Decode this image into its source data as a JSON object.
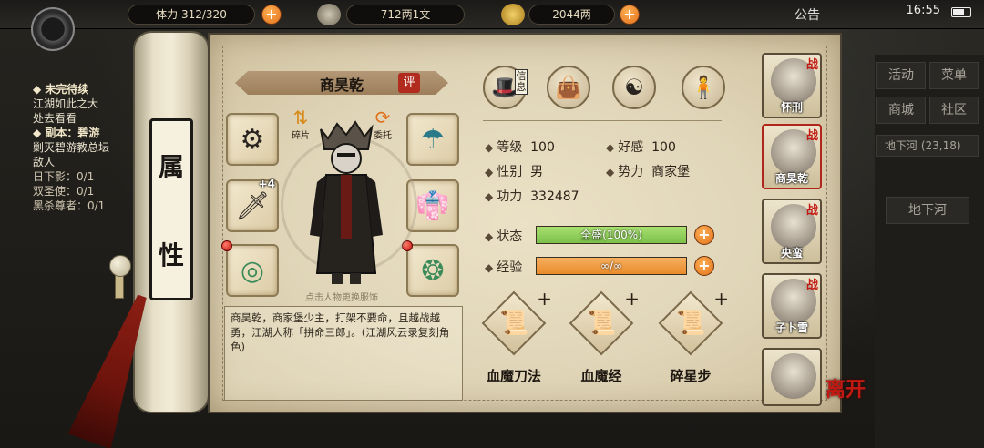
{
  "topbar": {
    "stamina": "体力 312/320",
    "copper": "712两1文",
    "silver": "2044两",
    "announce": "公告",
    "time": "16:55"
  },
  "quests": {
    "section1_title": "◆ 未完待续",
    "section1_line1": "江湖如此之大",
    "section1_line2": "处去看看",
    "section2_title": "◆ 副本：碧游",
    "section2_line1": "剿灭碧游教总坛",
    "section2_line2": "敌人",
    "line_a": "日下影：0/1",
    "line_b": "双圣使：0/1",
    "line_c": "黑杀尊者：0/1"
  },
  "right_menu": {
    "activity": "活动",
    "menu": "菜单",
    "shop": "商城",
    "community": "社区",
    "location": "地下河",
    "coords": "(23,18)",
    "location_btn": "地下河"
  },
  "scroll_label": [
    "属",
    "性"
  ],
  "character": {
    "name": "商昊乾",
    "eval": "评",
    "fragment_label": "碎片",
    "entrust_label": "委托",
    "change_hint": "点击人物更换服饰",
    "weapon_level": "+4",
    "bio": "商昊乾，商家堡少主，打架不要命，且越战越勇，江湖人称「拼命三郎」。(江湖风云录复刻角色)"
  },
  "tabs": {
    "info_tag": "信息"
  },
  "stats": {
    "level_label": "等级",
    "level_value": "100",
    "favor_label": "好感",
    "favor_value": "100",
    "gender_label": "性别",
    "gender_value": "男",
    "faction_label": "势力",
    "faction_value": "商家堡",
    "power_label": "功力",
    "power_value": "332487",
    "status_label": "状态",
    "status_value": "全盛(100%)",
    "status_ratio": 1.0,
    "exp_label": "经验",
    "exp_value": "∞/∞",
    "exp_ratio": 1.0
  },
  "skills": [
    {
      "name": "血魔刀法"
    },
    {
      "name": "血魔经"
    },
    {
      "name": "碎星步"
    }
  ],
  "party": [
    {
      "name": "怀刑",
      "tag": "战"
    },
    {
      "name": "商昊乾",
      "tag": "战"
    },
    {
      "name": "央蛮",
      "tag": "战"
    },
    {
      "name": "子卜雪",
      "tag": "战"
    },
    {
      "name": "",
      "tag": ""
    }
  ],
  "leave": "离开",
  "colors": {
    "status_bar": "#7cc04a",
    "exp_bar": "#e88a2a",
    "accent_red": "#b12c1e"
  }
}
